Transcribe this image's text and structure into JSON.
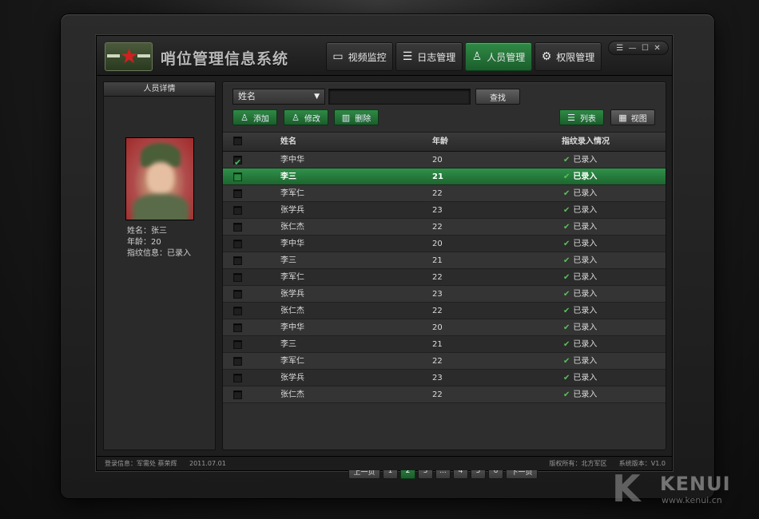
{
  "app": {
    "title": "哨位管理信息系统"
  },
  "nav": {
    "tabs": [
      {
        "label": "视频监控",
        "icon": "camera-icon",
        "active": false
      },
      {
        "label": "日志管理",
        "icon": "document-icon",
        "active": false
      },
      {
        "label": "人员管理",
        "icon": "user-icon",
        "active": true
      },
      {
        "label": "权限管理",
        "icon": "gear-icon",
        "active": false
      }
    ]
  },
  "window_controls": {
    "menu": "☰",
    "minimize": "—",
    "maximize": "☐",
    "close": "✕"
  },
  "left_panel": {
    "title": "人员详情",
    "name_line": "姓名：张三",
    "age_line": "年龄：20",
    "fingerprint_line": "指纹信息：已录入"
  },
  "search": {
    "field_select": "姓名",
    "query": "",
    "search_button": "查找"
  },
  "actions": {
    "add": "添加",
    "edit": "修改",
    "delete": "删除",
    "list_view": "列表",
    "grid_view": "视图"
  },
  "table": {
    "columns": {
      "name": "姓名",
      "age": "年龄",
      "status": "指纹录入情况"
    },
    "rows": [
      {
        "checked": true,
        "selected": false,
        "name": "李中华",
        "age": "20",
        "status": "已录入"
      },
      {
        "checked": false,
        "selected": true,
        "name": "李三",
        "age": "21",
        "status": "已录入"
      },
      {
        "checked": false,
        "selected": false,
        "name": "李军仁",
        "age": "22",
        "status": "已录入"
      },
      {
        "checked": false,
        "selected": false,
        "name": "张学兵",
        "age": "23",
        "status": "已录入"
      },
      {
        "checked": false,
        "selected": false,
        "name": "张仁杰",
        "age": "22",
        "status": "已录入"
      },
      {
        "checked": false,
        "selected": false,
        "name": "李中华",
        "age": "20",
        "status": "已录入"
      },
      {
        "checked": false,
        "selected": false,
        "name": "李三",
        "age": "21",
        "status": "已录入"
      },
      {
        "checked": false,
        "selected": false,
        "name": "李军仁",
        "age": "22",
        "status": "已录入"
      },
      {
        "checked": false,
        "selected": false,
        "name": "张学兵",
        "age": "23",
        "status": "已录入"
      },
      {
        "checked": false,
        "selected": false,
        "name": "张仁杰",
        "age": "22",
        "status": "已录入"
      },
      {
        "checked": false,
        "selected": false,
        "name": "李中华",
        "age": "20",
        "status": "已录入"
      },
      {
        "checked": false,
        "selected": false,
        "name": "李三",
        "age": "21",
        "status": "已录入"
      },
      {
        "checked": false,
        "selected": false,
        "name": "李军仁",
        "age": "22",
        "status": "已录入"
      },
      {
        "checked": false,
        "selected": false,
        "name": "张学兵",
        "age": "23",
        "status": "已录入"
      },
      {
        "checked": false,
        "selected": false,
        "name": "张仁杰",
        "age": "22",
        "status": "已录入"
      }
    ]
  },
  "pagination": {
    "prev": "上一页",
    "pages": [
      "1",
      "2",
      "3",
      "...",
      "4",
      "5",
      "6"
    ],
    "current": "2",
    "next": "下一页"
  },
  "footer": {
    "login_info": "登录信息：军需处 蔡荣辉",
    "date": "2011.07.01",
    "copyright": "版权所有：北方军区",
    "version": "系统版本：V1.0"
  },
  "watermark": {
    "brand": "KENUI",
    "url": "www.kenui.cn"
  },
  "colors": {
    "accent_green": "#2f8a45",
    "check_green": "#5ac15a",
    "logo_star": "#d02020"
  }
}
